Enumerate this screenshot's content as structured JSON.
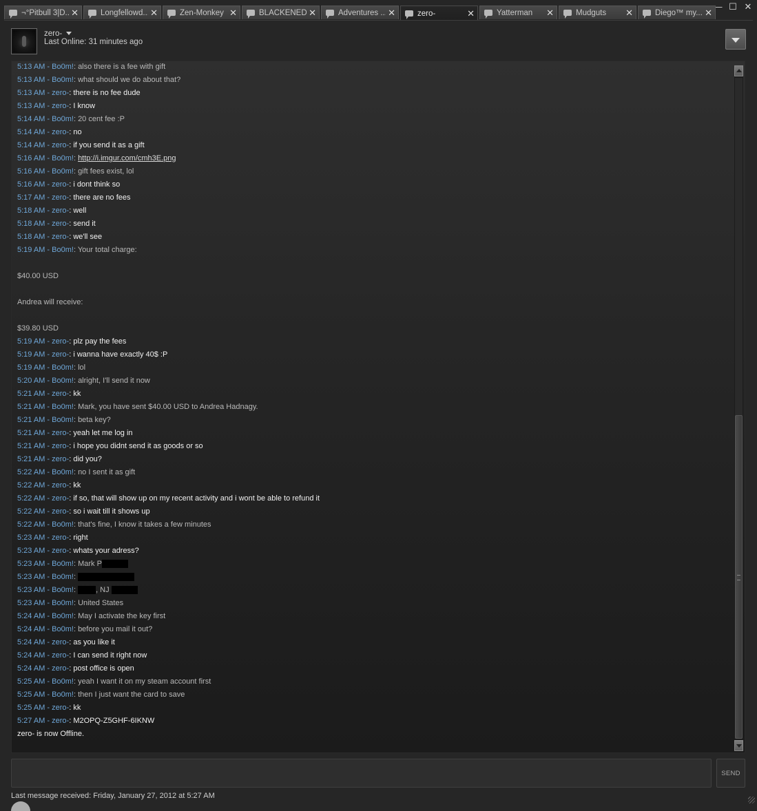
{
  "window": {
    "minimize": "—",
    "maximize": "☐",
    "close": "✕"
  },
  "tabs": [
    {
      "label": "¬°Pitbull 3|D...",
      "active": false
    },
    {
      "label": "Longfellowd...",
      "active": false
    },
    {
      "label": "Zen-Monkey",
      "active": false
    },
    {
      "label": "BLACKENED",
      "active": false
    },
    {
      "label": "Adventures ...",
      "active": false
    },
    {
      "label": "zero-",
      "active": true
    },
    {
      "label": "Yatterman",
      "active": false
    },
    {
      "label": "Mudguts",
      "active": false
    },
    {
      "label": "Diego™ my...",
      "active": false
    }
  ],
  "header": {
    "name": "zero-",
    "status": "Last Online: 31 minutes ago"
  },
  "chat": [
    {
      "time": "5:13 AM",
      "sender": "Bo0m!",
      "text": "also there is a fee with gift"
    },
    {
      "time": "5:13 AM",
      "sender": "Bo0m!",
      "text": "what should we do about that?"
    },
    {
      "time": "5:13 AM",
      "sender": "zero-",
      "text": "there is no fee dude"
    },
    {
      "time": "5:13 AM",
      "sender": "zero-",
      "text": "I know"
    },
    {
      "time": "5:14 AM",
      "sender": "Bo0m!",
      "text": "20 cent fee :P"
    },
    {
      "time": "5:14 AM",
      "sender": "zero-",
      "text": "no"
    },
    {
      "time": "5:14 AM",
      "sender": "zero-",
      "text": "if you send it as a gift"
    },
    {
      "time": "5:16 AM",
      "sender": "Bo0m!",
      "text": "http://i.imgur.com/cmh3E.png",
      "link": true
    },
    {
      "time": "5:16 AM",
      "sender": "Bo0m!",
      "text": "gift fees exist, lol"
    },
    {
      "time": "5:16 AM",
      "sender": "zero-",
      "text": "i dont think so"
    },
    {
      "time": "5:17 AM",
      "sender": "zero-",
      "text": "there are no fees"
    },
    {
      "time": "5:18 AM",
      "sender": "zero-",
      "text": "well"
    },
    {
      "time": "5:18 AM",
      "sender": "zero-",
      "text": "send it"
    },
    {
      "time": "5:18 AM",
      "sender": "zero-",
      "text": "we'll see"
    },
    {
      "time": "5:19 AM",
      "sender": "Bo0m!",
      "text": "Your total charge:"
    },
    {
      "continuation": true,
      "text": ""
    },
    {
      "continuation": true,
      "text": "$40.00 USD"
    },
    {
      "continuation": true,
      "text": ""
    },
    {
      "continuation": true,
      "text": "Andrea will receive:"
    },
    {
      "continuation": true,
      "text": ""
    },
    {
      "continuation": true,
      "text": "$39.80 USD"
    },
    {
      "time": "5:19 AM",
      "sender": "zero-",
      "text": "plz pay the fees"
    },
    {
      "time": "5:19 AM",
      "sender": "zero-",
      "text": "i wanna have exactly 40$ :P"
    },
    {
      "time": "5:19 AM",
      "sender": "Bo0m!",
      "text": "lol"
    },
    {
      "time": "5:20 AM",
      "sender": "Bo0m!",
      "text": "alright, I'll send it now"
    },
    {
      "time": "5:21 AM",
      "sender": "zero-",
      "text": "kk"
    },
    {
      "time": "5:21 AM",
      "sender": "Bo0m!",
      "text": "Mark, you have sent $40.00 USD to Andrea Hadnagy."
    },
    {
      "time": "5:21 AM",
      "sender": "Bo0m!",
      "text": "beta key?"
    },
    {
      "time": "5:21 AM",
      "sender": "zero-",
      "text": "yeah let me log in"
    },
    {
      "time": "5:21 AM",
      "sender": "zero-",
      "text": "i hope you didnt send it as goods or so"
    },
    {
      "time": "5:21 AM",
      "sender": "zero-",
      "text": "did you?"
    },
    {
      "time": "5:22 AM",
      "sender": "Bo0m!",
      "text": "no I sent it as gift"
    },
    {
      "time": "5:22 AM",
      "sender": "zero-",
      "text": "kk"
    },
    {
      "time": "5:22 AM",
      "sender": "zero-",
      "text": "if so, that will show up on my recent activity and i wont be able to refund it"
    },
    {
      "time": "5:22 AM",
      "sender": "zero-",
      "text": "so i wait till it shows up"
    },
    {
      "time": "5:22 AM",
      "sender": "Bo0m!",
      "text": "that's fine, I know it takes a few minutes"
    },
    {
      "time": "5:23 AM",
      "sender": "zero-",
      "text": "right"
    },
    {
      "time": "5:23 AM",
      "sender": "zero-",
      "text": "whats your adress?"
    },
    {
      "time": "5:23 AM",
      "sender": "Bo0m!",
      "text": "Mark P",
      "redact_after": 38
    },
    {
      "time": "5:23 AM",
      "sender": "Bo0m!",
      "text": "",
      "redact_after": 82
    },
    {
      "time": "5:23 AM",
      "sender": "Bo0m!",
      "text": "",
      "redact_mid": true,
      "mid_text": ", NJ"
    },
    {
      "time": "5:23 AM",
      "sender": "Bo0m!",
      "text": "United States"
    },
    {
      "time": "5:24 AM",
      "sender": "Bo0m!",
      "text": "May I activate the key first"
    },
    {
      "time": "5:24 AM",
      "sender": "Bo0m!",
      "text": "before you mail it out?"
    },
    {
      "time": "5:24 AM",
      "sender": "zero-",
      "text": "as you like it"
    },
    {
      "time": "5:24 AM",
      "sender": "zero-",
      "text": "I can send it right now"
    },
    {
      "time": "5:24 AM",
      "sender": "zero-",
      "text": "post office is open"
    },
    {
      "time": "5:25 AM",
      "sender": "Bo0m!",
      "text": "yeah I want it on my steam account first"
    },
    {
      "time": "5:25 AM",
      "sender": "Bo0m!",
      "text": "then I just want the card to save"
    },
    {
      "time": "5:25 AM",
      "sender": "zero-",
      "text": "kk"
    },
    {
      "time": "5:27 AM",
      "sender": "zero-",
      "text": "M2OPQ-Z5GHF-6IKNW"
    },
    {
      "status": true,
      "text": "zero- is now Offline."
    }
  ],
  "scroll_position": 0.55,
  "input": {
    "value": ""
  },
  "send_label": "SEND",
  "footer": "Last message received: Friday, January 27, 2012 at 5:27 AM"
}
